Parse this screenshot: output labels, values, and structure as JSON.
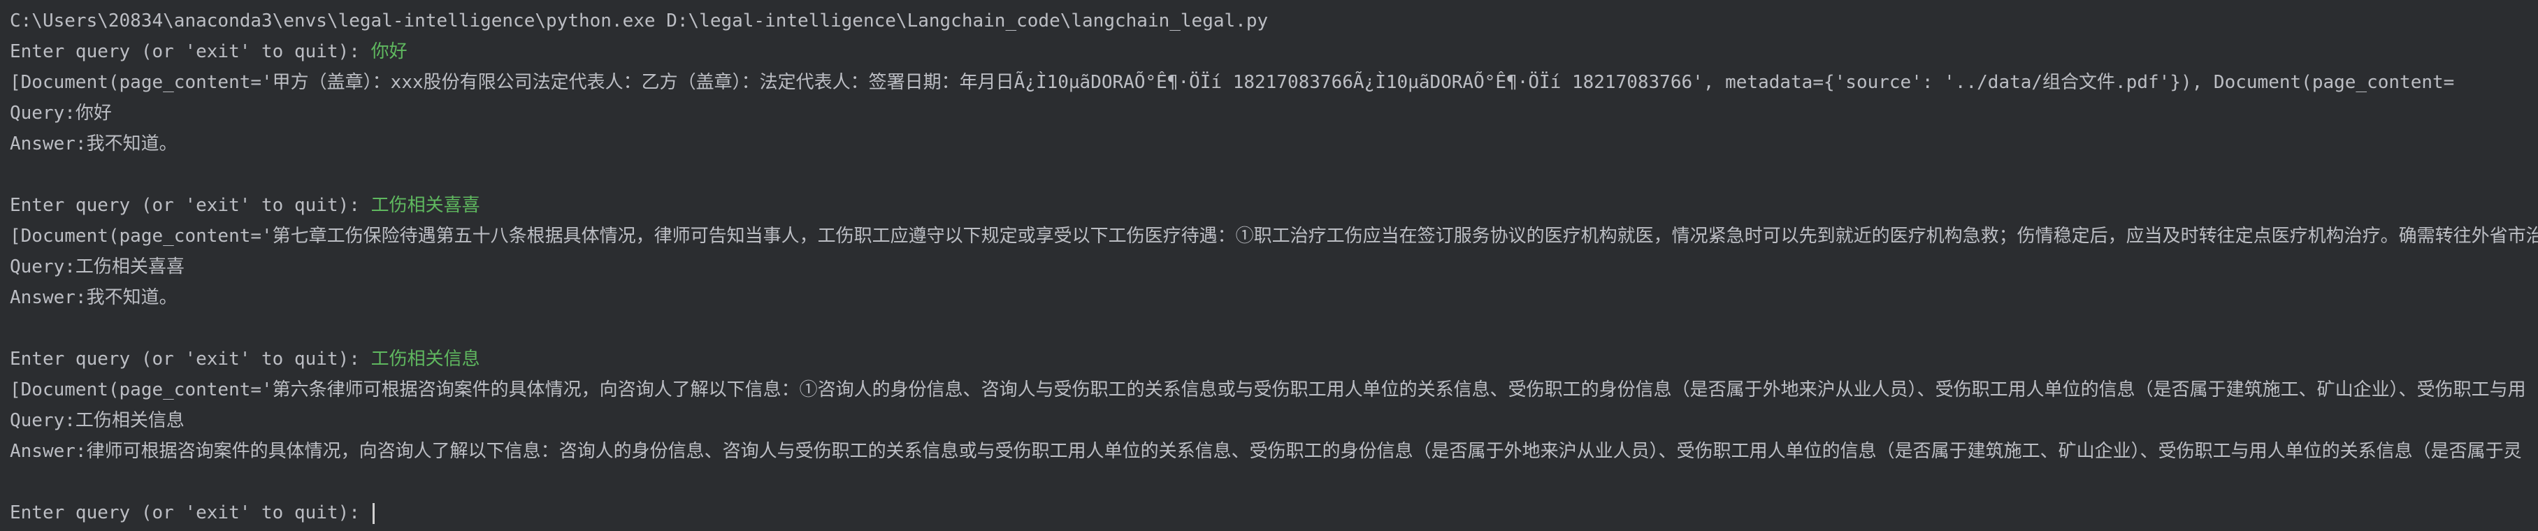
{
  "command_line": "C:\\Users\\20834\\anaconda3\\envs\\legal-intelligence\\python.exe D:\\legal-intelligence\\Langchain_code\\langchain_legal.py",
  "prompt_label": "Enter query (or 'exit' to quit): ",
  "exchanges": [
    {
      "input": "你好",
      "documents": "[Document(page_content='甲方（盖章）：xxx股份有限公司法定代表人：乙方（盖章）：法定代表人：签署日期：年月日Ã¿Ì10µãDORAÕ°Ê¶·ÖÏí 18217083766Ã¿Ì10µãDORAÕ°Ê¶·ÖÏí 18217083766', metadata={'source': '../data/组合文件.pdf'}), Document(page_content=",
      "query": "Query:你好",
      "answer": "Answer:我不知道。"
    },
    {
      "input": "工伤相关喜喜",
      "documents": "[Document(page_content='第七章工伤保险待遇第五十八条根据具体情况，律师可告知当事人，工伤职工应遵守以下规定或享受以下工伤医疗待遇：①职工治疗工伤应当在签订服务协议的医疗机构就医，情况紧急时可以先到就近的医疗机构急救；伤情稳定后，应当及时转往定点医疗机构治疗。确需转往外省市治",
      "query": "Query:工伤相关喜喜",
      "answer": "Answer:我不知道。"
    },
    {
      "input": "工伤相关信息",
      "documents": "[Document(page_content='第六条律师可根据咨询案件的具体情况，向咨询人了解以下信息：①咨询人的身份信息、咨询人与受伤职工的关系信息或与受伤职工用人单位的关系信息、受伤职工的身份信息（是否属于外地来沪从业人员）、受伤职工用人单位的信息（是否属于建筑施工、矿山企业）、受伤职工与用",
      "query": "Query:工伤相关信息",
      "answer": "Answer:律师可根据咨询案件的具体情况，向咨询人了解以下信息：咨询人的身份信息、咨询人与受伤职工的关系信息或与受伤职工用人单位的关系信息、受伤职工的身份信息（是否属于外地来沪从业人员）、受伤职工用人单位的信息（是否属于建筑施工、矿山企业）、受伤职工与用人单位的关系信息（是否属于灵"
    }
  ],
  "colors": {
    "background": "#2b2d30",
    "text": "#bcbec4",
    "user_input": "#5fb85f"
  }
}
